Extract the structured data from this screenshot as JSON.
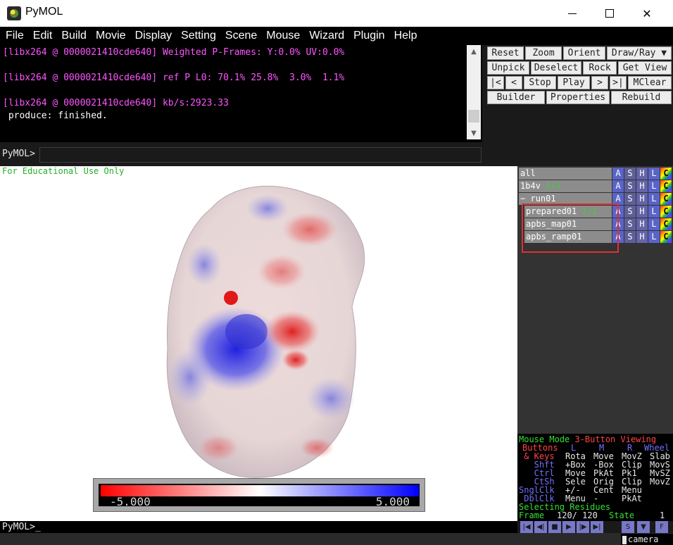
{
  "window": {
    "title": "PyMOL",
    "minimize_icon": "minimize-icon",
    "maximize_icon": "maximize-icon",
    "close_glyph": "✕"
  },
  "menu": [
    "File",
    "Edit",
    "Build",
    "Movie",
    "Display",
    "Setting",
    "Scene",
    "Mouse",
    "Wizard",
    "Plugin",
    "Help"
  ],
  "log": [
    {
      "text": "[libx264 @ 0000021410cde640] Weighted P-Frames: Y:0.0% UV:0.0%",
      "color": "pink"
    },
    {
      "text": "",
      "color": "white"
    },
    {
      "text": "[libx264 @ 0000021410cde640] ref P L0: 70.1% 25.8%  3.0%  1.1%",
      "color": "pink"
    },
    {
      "text": "",
      "color": "white"
    },
    {
      "text": "[libx264 @ 0000021410cde640] kb/s:2923.33",
      "color": "pink"
    },
    {
      "text": " produce: finished.",
      "color": "white"
    }
  ],
  "command": {
    "prompt": "PyMOL>",
    "value": ""
  },
  "buttons": {
    "row1": [
      "Reset",
      "Zoom",
      "Orient",
      "Draw/Ray ▼"
    ],
    "row2": [
      "Unpick",
      "Deselect",
      "Rock",
      "Get View"
    ],
    "row3": [
      "|<",
      "<",
      "Stop",
      "Play",
      ">",
      ">|",
      "MClear"
    ],
    "row4": [
      "Builder",
      "Properties",
      "Rebuild"
    ]
  },
  "viewer": {
    "watermark": "For Educational Use Only",
    "ramp_min": "-5.000",
    "ramp_max": "5.000",
    "ramp_colors": [
      "#ff0000",
      "#ffffff",
      "#0000ff"
    ]
  },
  "objects": [
    {
      "name": "all",
      "state": "",
      "indent": 0,
      "toggle": ""
    },
    {
      "name": "1b4v",
      "state": "1/1",
      "indent": 0,
      "toggle": ""
    },
    {
      "name": "run01",
      "state": "",
      "indent": 0,
      "toggle": "−"
    },
    {
      "name": "prepared01",
      "state": "1/1",
      "indent": 1,
      "toggle": ""
    },
    {
      "name": "apbs_map01",
      "state": "",
      "indent": 1,
      "toggle": ""
    },
    {
      "name": "apbs_ramp01",
      "state": "",
      "indent": 1,
      "toggle": ""
    }
  ],
  "object_buttons": [
    "A",
    "S",
    "H",
    "L",
    "C"
  ],
  "mouse_panel": {
    "line1": {
      "a": "Mouse Mode ",
      "b": "3-Button Viewing"
    },
    "line2": {
      "a": "Buttons",
      "l": "L",
      "m": "M",
      "r": "R",
      "w": "Wheel"
    },
    "rows": [
      {
        "label": " & Keys",
        "cols": [
          "Rota",
          "Move",
          "MovZ",
          "Slab"
        ]
      },
      {
        "label": "   Shft",
        "cols": [
          "+Box",
          "-Box",
          "Clip",
          "MovS"
        ]
      },
      {
        "label": "   Ctrl",
        "cols": [
          "Move",
          "PkAt",
          "Pk1",
          "MvSZ"
        ]
      },
      {
        "label": "   CtSh",
        "cols": [
          "Sele",
          "Orig",
          "Clip",
          "MovZ"
        ]
      },
      {
        "label": "SnglClk",
        "cols": [
          "+/-",
          "Cent",
          "Menu",
          ""
        ]
      },
      {
        "label": " DblClk",
        "cols": [
          "Menu",
          "-",
          "PkAt",
          ""
        ]
      }
    ],
    "selecting": "Selecting Residues",
    "frame_label": "Frame",
    "frame_value": "120/ 120",
    "state_label": "State",
    "state_value": "1"
  },
  "frame_controls": [
    "|◀",
    "◀|",
    "■",
    "▶",
    "|▶",
    "▶|",
    "S",
    "▼",
    "F"
  ],
  "bottom_prompt": "PyMOL>_",
  "status_field": "camera"
}
